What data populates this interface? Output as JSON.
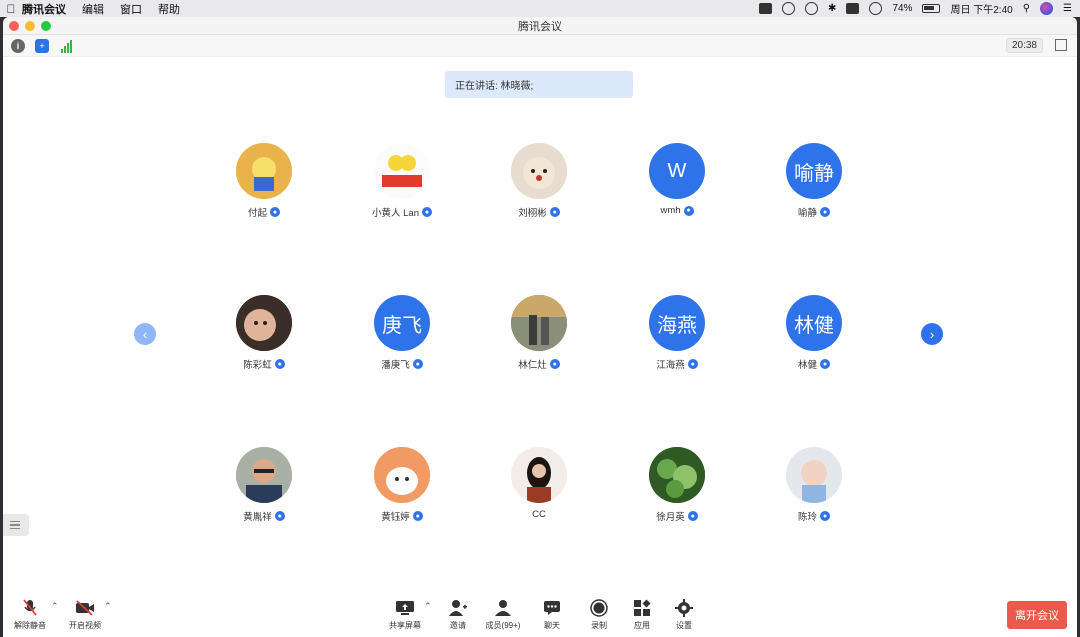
{
  "menubar": {
    "app": "腾讯会议",
    "menus": [
      "编辑",
      "窗口",
      "帮助"
    ],
    "battery": "74%",
    "datetime": "周日 下午2:40"
  },
  "window": {
    "title": "腾讯会议",
    "timer": "20:38"
  },
  "speaker": {
    "text": "正在讲话: 林晓薇;"
  },
  "participants": [
    {
      "name": "付起",
      "avatar_text": ""
    },
    {
      "name": "小黄人 Lan",
      "avatar_text": ""
    },
    {
      "name": "刘栩彬",
      "avatar_text": ""
    },
    {
      "name": "wmh",
      "avatar_text": "W"
    },
    {
      "name": "喻静",
      "avatar_text": "喻静"
    },
    {
      "name": "陈彩虹",
      "avatar_text": ""
    },
    {
      "name": "潘庚飞",
      "avatar_text": "庚飞"
    },
    {
      "name": "林仁灶",
      "avatar_text": ""
    },
    {
      "name": "江海燕",
      "avatar_text": "海燕"
    },
    {
      "name": "林健",
      "avatar_text": "林健"
    },
    {
      "name": "黄胤祥",
      "avatar_text": ""
    },
    {
      "name": "黄钰婷",
      "avatar_text": ""
    },
    {
      "name": "CC",
      "avatar_text": ""
    },
    {
      "name": "徐月英",
      "avatar_text": ""
    },
    {
      "name": "陈玲",
      "avatar_text": ""
    }
  ],
  "toolbar": {
    "unmute": "解除静音",
    "start_video": "开启视频",
    "share_screen": "共享屏幕",
    "invite": "邀请",
    "members": "成员(99+)",
    "chat": "聊天",
    "record": "录制",
    "apps": "应用",
    "settings": "设置",
    "leave": "离开会议"
  },
  "colors": {
    "accent": "#2f73ea",
    "leave": "#ea5a4b",
    "speaker_bg": "#dce9fb"
  }
}
